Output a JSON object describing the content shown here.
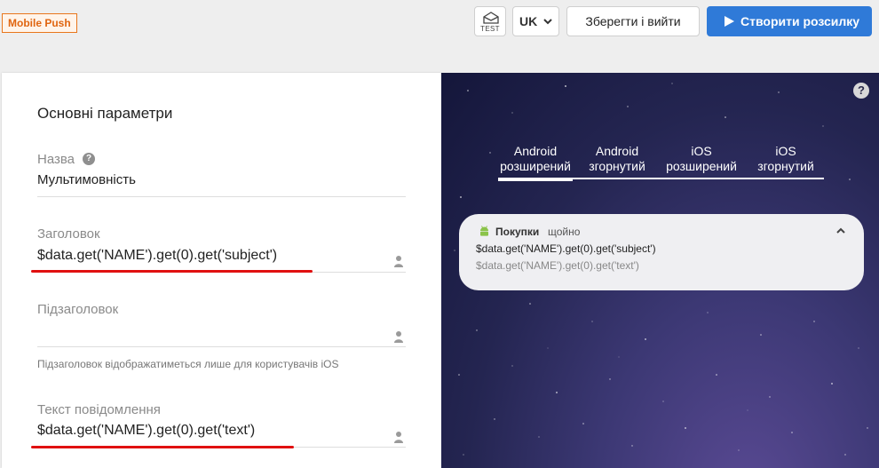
{
  "toolbar": {
    "channel_tag": "Mobile Push",
    "test_icon": "envelope-test-icon",
    "test_label": "TEST",
    "language": "UK",
    "save_exit": "Зберегти і вийти",
    "create": "Створити розсилку",
    "accent_color": "#2f7ad8"
  },
  "form": {
    "section_title": "Основні параметри",
    "name": {
      "label": "Назва",
      "value": "Мультимовність"
    },
    "title": {
      "label": "Заголовок",
      "value": "$data.get('NAME').get(0).get('subject')"
    },
    "subtitle": {
      "label": "Підзаголовок",
      "value": "",
      "hint": "Підзаголовок відображатиметься лише для користувачів iOS"
    },
    "message": {
      "label": "Текст повідомлення",
      "value": "$data.get('NAME').get(0).get('text')"
    }
  },
  "preview": {
    "help": "?",
    "tabs": [
      {
        "line1": "Android",
        "line2": "розширений",
        "active": true
      },
      {
        "line1": "Android",
        "line2": "згорнутий",
        "active": false
      },
      {
        "line1": "iOS",
        "line2": "розширений",
        "active": false
      },
      {
        "line1": "iOS",
        "line2": "згорнутий",
        "active": false
      }
    ],
    "notification": {
      "app_name": "Покупки",
      "time": "щойно",
      "title": "$data.get('NAME').get(0).get('subject')",
      "text": "$data.get('NAME').get(0).get('text')"
    }
  }
}
